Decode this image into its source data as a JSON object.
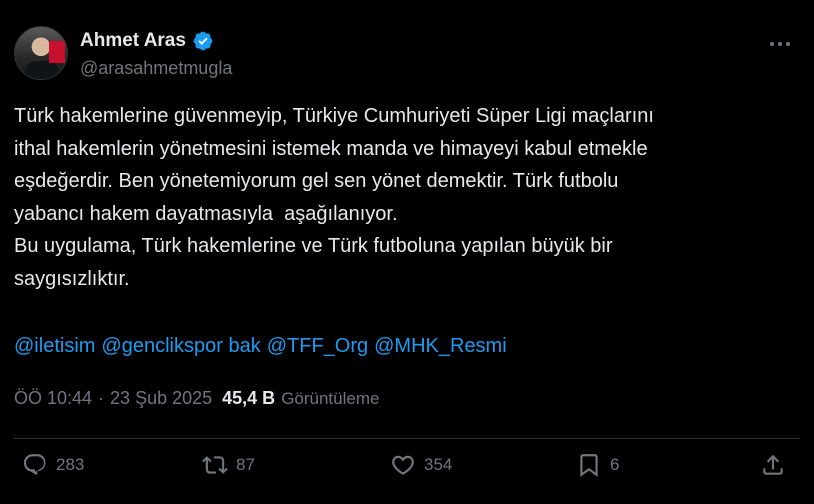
{
  "author": {
    "display_name": "Ahmet Aras",
    "handle": "@arasahmetmugla",
    "verified": true
  },
  "tweet": {
    "text": "Türk hakemlerine güvenmeyip, Türkiye Cumhuriyeti Süper Ligi maçlarını\nithal hakemlerin yönetmesini istemek manda ve himayeyi kabul etmekle\neşdeğerdir. Ben yönetemiyorum gel sen yönet demektir. Türk futbolu\nyabancı hakem dayatmasıyla  aşağılanıyor.\nBu uygulama, Türk hakemlerine ve Türk futboluna yapılan büyük bir\nsaygısızlıktır.",
    "mentions": [
      "@iletisim",
      "@genclikspor bak",
      "@TFF_Org",
      "@MHK_Resmi"
    ]
  },
  "meta": {
    "time": "ÖÖ 10:44",
    "separator": "·",
    "date": "23 Şub 2025",
    "views_count": "45,4 B",
    "views_label": "Görüntüleme"
  },
  "actions": {
    "replies": "283",
    "reposts": "87",
    "likes": "354",
    "bookmarks": "6"
  },
  "colors": {
    "background": "#000000",
    "text": "#e7e9ea",
    "secondary": "#71767b",
    "link": "#1d9bf0",
    "divider": "#2f3336"
  },
  "icons": [
    "verified-badge-icon",
    "more-icon",
    "reply-icon",
    "repost-icon",
    "like-icon",
    "bookmark-icon",
    "share-icon"
  ]
}
